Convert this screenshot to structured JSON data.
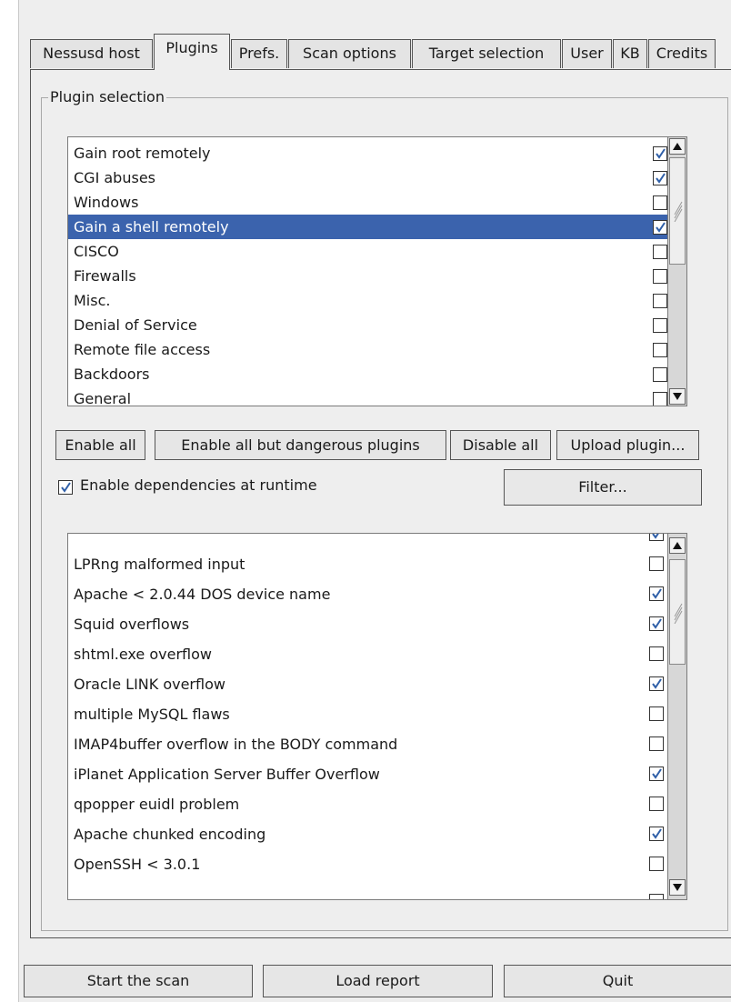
{
  "tabs": [
    "Nessusd host",
    "Plugins",
    "Prefs.",
    "Scan options",
    "Target selection",
    "User",
    "KB",
    "Credits"
  ],
  "active_tab": "Plugins",
  "plugin_selection": {
    "title": "Plugin selection",
    "families": [
      {
        "label": "Gain root remotely",
        "checked": true
      },
      {
        "label": "CGI abuses",
        "checked": true
      },
      {
        "label": "Windows",
        "checked": false
      },
      {
        "label": "Gain a shell remotely",
        "checked": true,
        "selected": true
      },
      {
        "label": "CISCO",
        "checked": false
      },
      {
        "label": "Firewalls",
        "checked": false
      },
      {
        "label": "Misc.",
        "checked": false
      },
      {
        "label": "Denial of Service",
        "checked": false
      },
      {
        "label": "Remote file access",
        "checked": false
      },
      {
        "label": "Backdoors",
        "checked": false
      },
      {
        "label": "General",
        "checked": false
      }
    ],
    "buttons": {
      "enable_all": "Enable all",
      "enable_all_but_dangerous": "Enable all but dangerous plugins",
      "disable_all": "Disable all",
      "upload_plugin": "Upload plugin..."
    },
    "enable_dependencies": {
      "label": "Enable dependencies at runtime",
      "checked": true
    },
    "filter_button": "Filter...",
    "plugins": [
      {
        "label": "LPRng malformed input",
        "checked": false
      },
      {
        "label": "Apache < 2.0.44 DOS device name",
        "checked": true
      },
      {
        "label": "Squid overflows",
        "checked": true
      },
      {
        "label": "shtml.exe overflow",
        "checked": false
      },
      {
        "label": "Oracle LINK overflow",
        "checked": true
      },
      {
        "label": "multiple MySQL flaws",
        "checked": false
      },
      {
        "label": "IMAP4buffer overflow in the BODY command",
        "checked": false
      },
      {
        "label": "iPlanet Application Server Buffer Overflow",
        "checked": true
      },
      {
        "label": "qpopper euidl problem",
        "checked": false
      },
      {
        "label": "Apache chunked encoding",
        "checked": true
      },
      {
        "label": "OpenSSH < 3.0.1",
        "checked": false
      }
    ]
  },
  "bottom_buttons": {
    "start_scan": "Start the scan",
    "load_report": "Load report",
    "quit": "Quit"
  },
  "icons": {
    "checkmark": "checkmark-icon",
    "scroll_up": "arrow-up-icon",
    "scroll_down": "arrow-down-icon"
  },
  "colors": {
    "selection": "#3b63ad",
    "check": "#2f5fa8"
  }
}
